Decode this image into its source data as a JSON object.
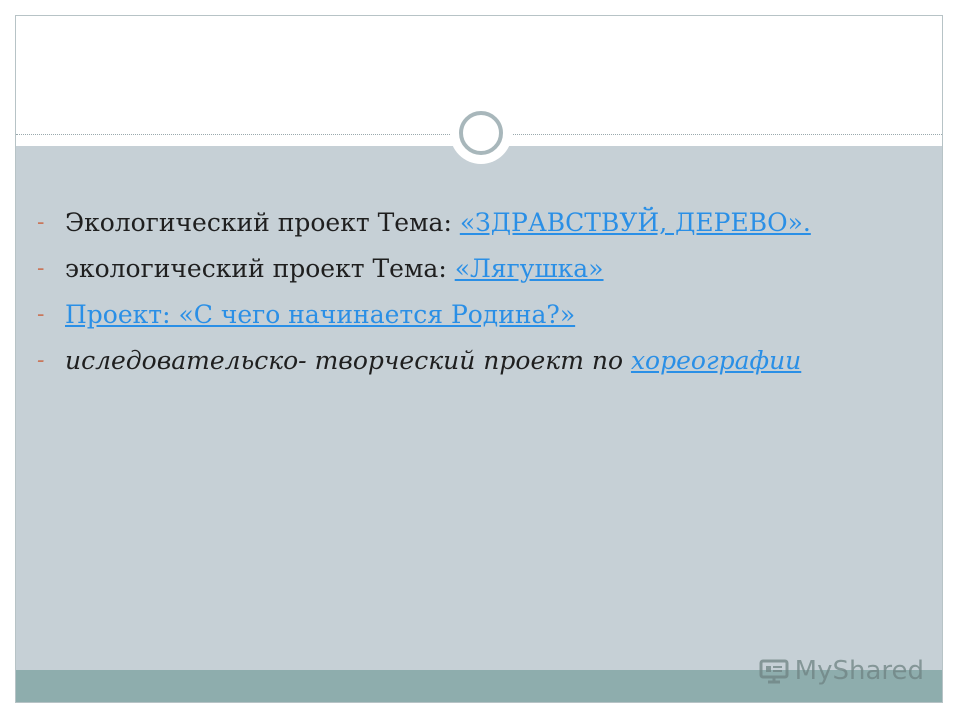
{
  "slide": {
    "items": [
      {
        "text": "Экологический проект Тема: ",
        "link": "«ЗДРАВСТВУЙ, ДЕРЕВО».",
        "italic": false
      },
      {
        "text": "экологический проект Тема: ",
        "link": "«Лягушка»",
        "italic": false
      },
      {
        "text": "",
        "link": "Проект: «С чего начинается Родина?»",
        "italic": false
      },
      {
        "text": "иследовательско- творческий проект по ",
        "link": "хореографии",
        "italic": true
      }
    ],
    "bullet_glyph": "-"
  },
  "watermark": {
    "text": "MyShared",
    "icon": "presentation-screen-icon"
  },
  "colors": {
    "content_background": "#c6d0d6",
    "footer_band": "#8eadad",
    "link": "#2a8fe6",
    "bullet_dash": "#c9775b",
    "body_text": "#1f1f1f"
  }
}
